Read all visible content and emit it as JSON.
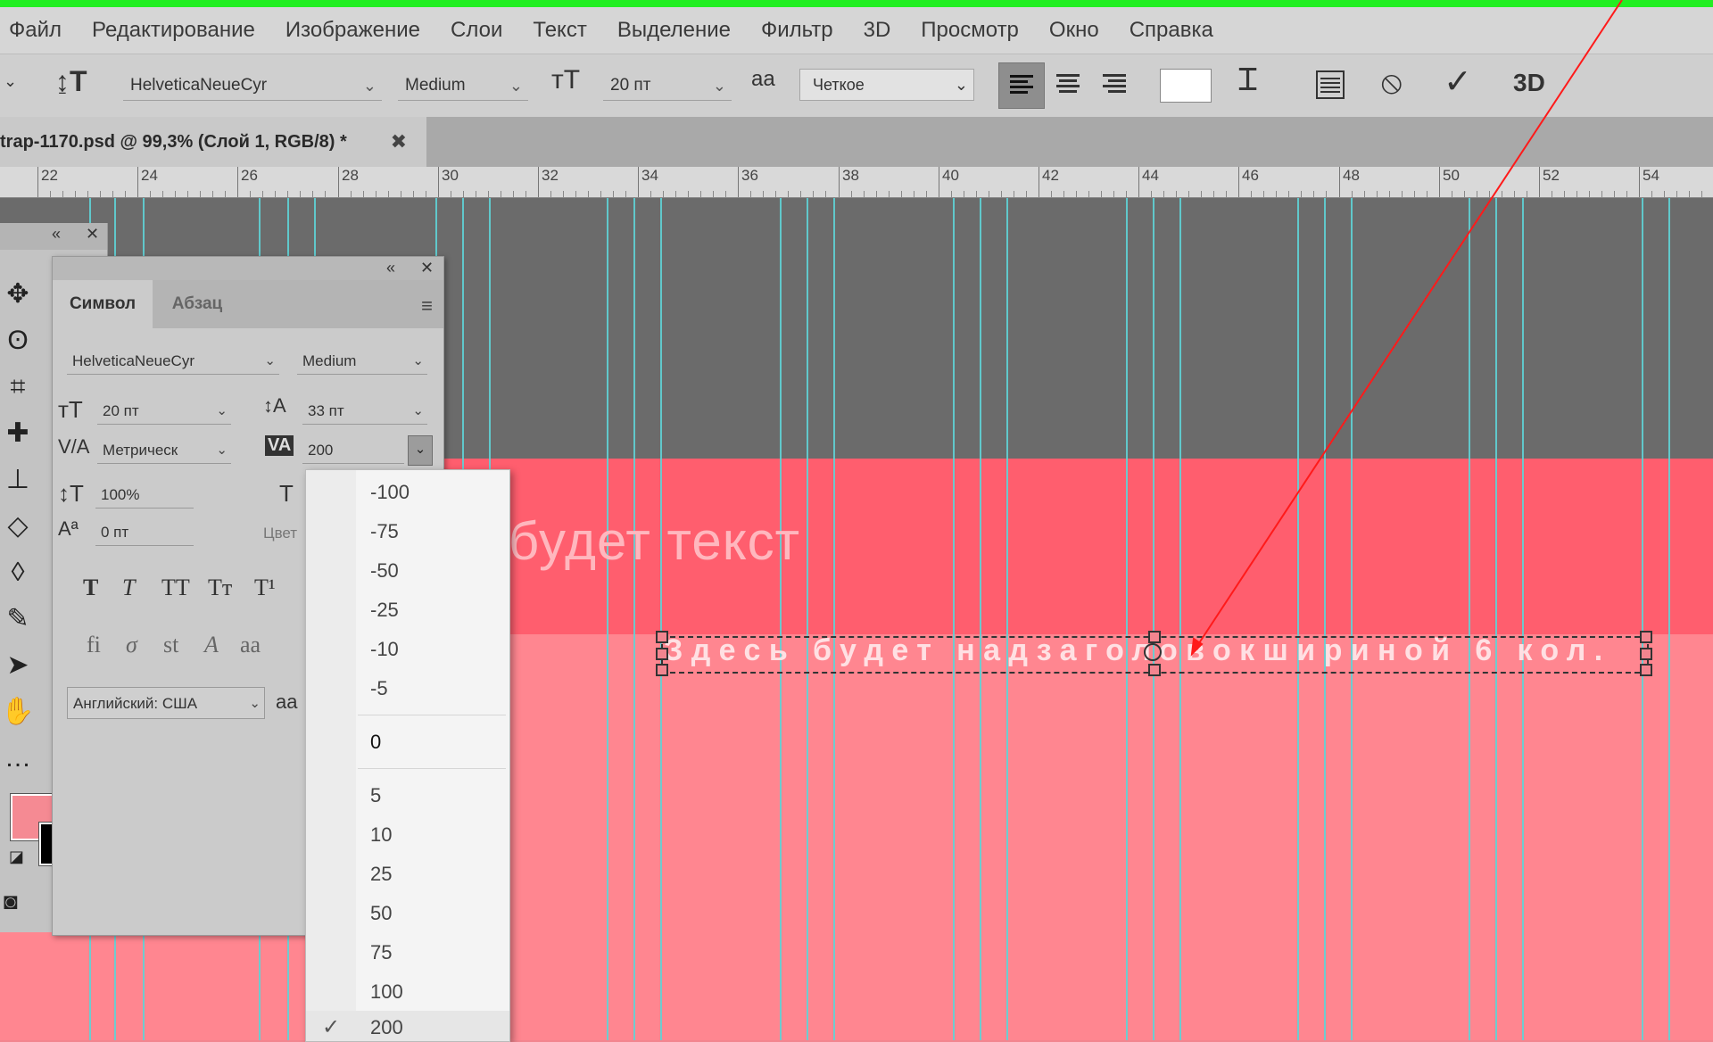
{
  "menu": [
    "Файл",
    "Редактирование",
    "Изображение",
    "Слои",
    "Текст",
    "Выделение",
    "Фильтр",
    "3D",
    "Просмотр",
    "Окно",
    "Справка"
  ],
  "options_bar": {
    "font_family": "HelveticaNeueCyr",
    "font_style": "Medium",
    "font_size": "20 пт",
    "antialias_icon": "aa",
    "antialias": "Четкое",
    "icon_3d": "3D"
  },
  "document_tab": {
    "title": "trap-1170.psd @ 99,3% (Слой 1, RGB/8) *",
    "close": "✖"
  },
  "ruler": [
    "22",
    "24",
    "26",
    "28",
    "30",
    "32",
    "34",
    "36",
    "38",
    "40",
    "42",
    "44",
    "46",
    "48",
    "50",
    "52",
    "54"
  ],
  "canvas": {
    "headline": "ь будет текст",
    "subtext": "Здесь будет надзаголовокшириной 6 кол."
  },
  "character_panel": {
    "tabs": [
      "Символ",
      "Абзац"
    ],
    "font_family": "HelveticaNeueCyr",
    "font_style": "Medium",
    "size": "20 пт",
    "leading": "33 пт",
    "kerning": "Метрическ",
    "tracking": "200",
    "vertical_scale": "100%",
    "baseline_shift": "0 пт",
    "color_label": "Цвет",
    "language": "Английский: США",
    "aa_icon": "aa",
    "tracking_icon_text": "VA"
  },
  "tracking_dropdown": {
    "negative": [
      "-100",
      "-75",
      "-50",
      "-25",
      "-10",
      "-5"
    ],
    "zero": "0",
    "positive": [
      "5",
      "10",
      "25",
      "50",
      "75",
      "100",
      "200"
    ],
    "selected": "200",
    "check": "✓"
  },
  "colors": {
    "foreground": "#f58a93",
    "background": "#000000",
    "accent_guide": "#5fd3d6",
    "arrow": "#ff1a1a"
  }
}
